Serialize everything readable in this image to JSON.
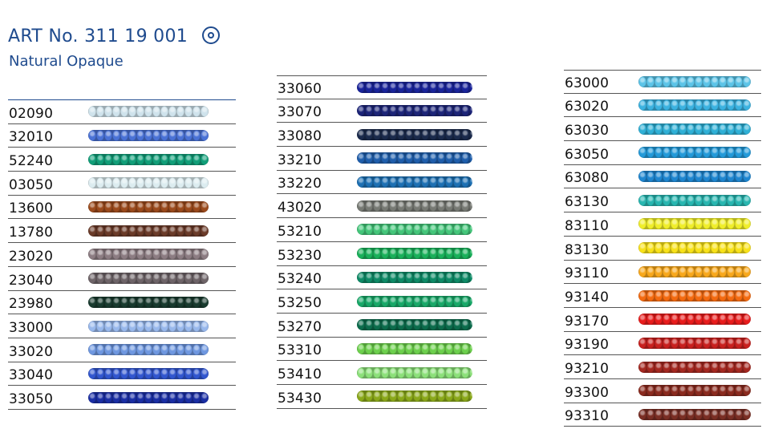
{
  "header": {
    "title": "ART No. 311 19 001",
    "subtitle": "Natural Opaque",
    "symbol_icon": "double-circle-icon"
  },
  "columns": [
    {
      "rows": [
        {
          "code": "02090",
          "color": "#cfe3ec"
        },
        {
          "code": "32010",
          "color": "#4a72d6"
        },
        {
          "code": "52240",
          "color": "#109e78"
        },
        {
          "code": "03050",
          "color": "#dcecf0"
        },
        {
          "code": "13600",
          "color": "#9b4a1c"
        },
        {
          "code": "13780",
          "color": "#6a3a28"
        },
        {
          "code": "23020",
          "color": "#8c7c82"
        },
        {
          "code": "23040",
          "color": "#6e6468"
        },
        {
          "code": "23980",
          "color": "#183a2e"
        },
        {
          "code": "33000",
          "color": "#98b8ec"
        },
        {
          "code": "33020",
          "color": "#6e97e0"
        },
        {
          "code": "33040",
          "color": "#3156cf"
        },
        {
          "code": "33050",
          "color": "#1a2ea4"
        }
      ]
    },
    {
      "rows": [
        {
          "code": "33060",
          "color": "#19239a"
        },
        {
          "code": "33070",
          "color": "#1c2478"
        },
        {
          "code": "33080",
          "color": "#1a2a4c"
        },
        {
          "code": "33210",
          "color": "#1f5eab"
        },
        {
          "code": "33220",
          "color": "#1d70b3"
        },
        {
          "code": "43020",
          "color": "#777a74"
        },
        {
          "code": "53210",
          "color": "#44c67a"
        },
        {
          "code": "53230",
          "color": "#19b05a"
        },
        {
          "code": "53240",
          "color": "#0d8a66"
        },
        {
          "code": "53250",
          "color": "#18a868"
        },
        {
          "code": "53270",
          "color": "#0b6c4c"
        },
        {
          "code": "53310",
          "color": "#6dd04d"
        },
        {
          "code": "53410",
          "color": "#8ce07a"
        },
        {
          "code": "53430",
          "color": "#8aa81a"
        }
      ]
    },
    {
      "rows": [
        {
          "code": "63000",
          "color": "#5cc4e8"
        },
        {
          "code": "63020",
          "color": "#3bb2e0"
        },
        {
          "code": "63030",
          "color": "#2fb0d6"
        },
        {
          "code": "63050",
          "color": "#239ad9"
        },
        {
          "code": "63080",
          "color": "#1e86d0"
        },
        {
          "code": "63130",
          "color": "#28b6b0"
        },
        {
          "code": "83110",
          "color": "#f0ee2a"
        },
        {
          "code": "83130",
          "color": "#f8e21a"
        },
        {
          "code": "93110",
          "color": "#f8a81c"
        },
        {
          "code": "93140",
          "color": "#f36a10"
        },
        {
          "code": "93170",
          "color": "#e81c1c"
        },
        {
          "code": "93190",
          "color": "#c8201e"
        },
        {
          "code": "93210",
          "color": "#a42820"
        },
        {
          "code": "93300",
          "color": "#8a2a1e"
        },
        {
          "code": "93310",
          "color": "#7a2e24"
        }
      ]
    }
  ]
}
